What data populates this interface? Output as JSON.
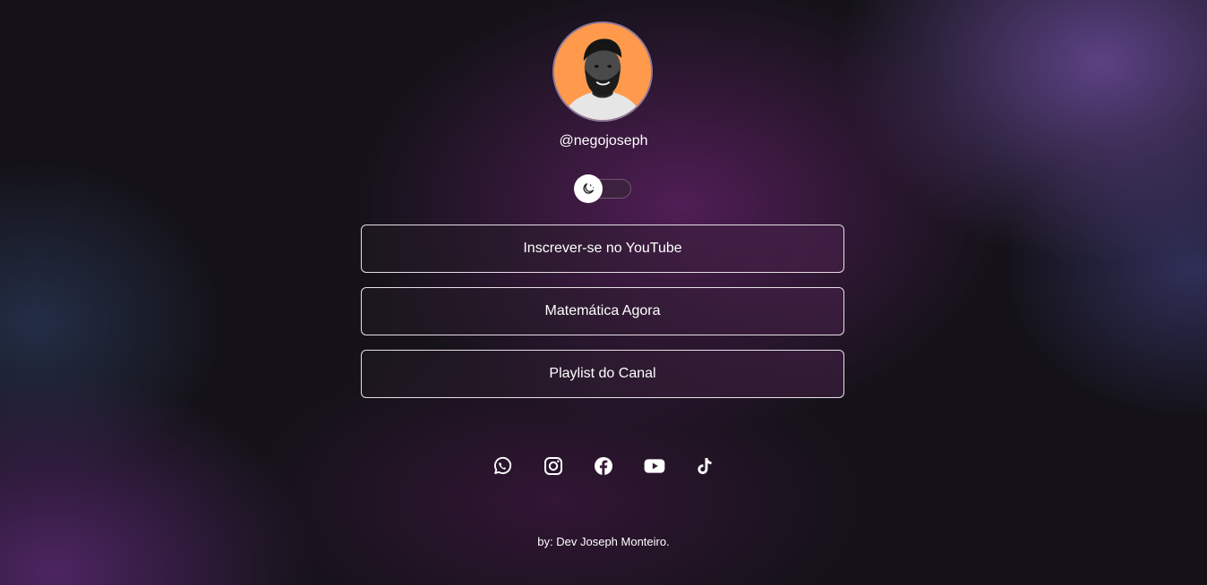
{
  "profile": {
    "username": "@negojoseph"
  },
  "theme_toggle": {
    "state": "dark"
  },
  "links": [
    {
      "label": "Inscrever-se no YouTube"
    },
    {
      "label": "Matemática Agora"
    },
    {
      "label": "Playlist do Canal"
    }
  ],
  "socials": [
    {
      "icon": "whatsapp-icon"
    },
    {
      "icon": "instagram-icon"
    },
    {
      "icon": "facebook-icon"
    },
    {
      "icon": "youtube-icon"
    },
    {
      "icon": "tiktok-icon"
    }
  ],
  "footer": {
    "credit": "by: Dev Joseph Monteiro."
  },
  "colors": {
    "avatar_background": "#ff9a4d",
    "button_border": "#e8dfe8",
    "text": "#ffffff"
  }
}
